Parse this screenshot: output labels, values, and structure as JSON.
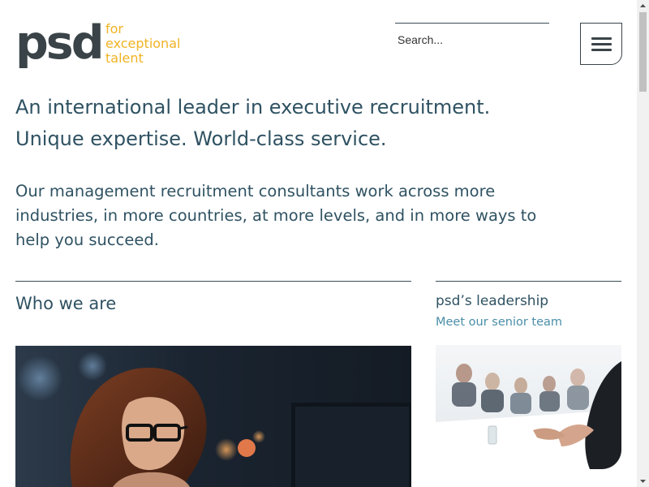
{
  "header": {
    "logo": {
      "wordmark": "psd",
      "tagline": [
        "for",
        "exceptional",
        "talent"
      ],
      "brand_color": "#f0b323",
      "wordmark_color": "#3a4448"
    },
    "search": {
      "placeholder": "Search...",
      "value": ""
    },
    "menu_icon": "hamburger-icon"
  },
  "hero": {
    "headline_lines": [
      "An international leader in executive recruitment.",
      "Unique expertise. World-class service."
    ],
    "intro": "Our management recruitment consultants work across more industries, in more countries, at more levels, and in more ways to help you succeed."
  },
  "who_we_are": {
    "title": "Who we are"
  },
  "leadership": {
    "title": "psd’s leadership",
    "link": "Meet our senior team"
  },
  "colors": {
    "text": "#2f5262",
    "link": "#4a8ea8",
    "rule": "#3a4d55"
  }
}
